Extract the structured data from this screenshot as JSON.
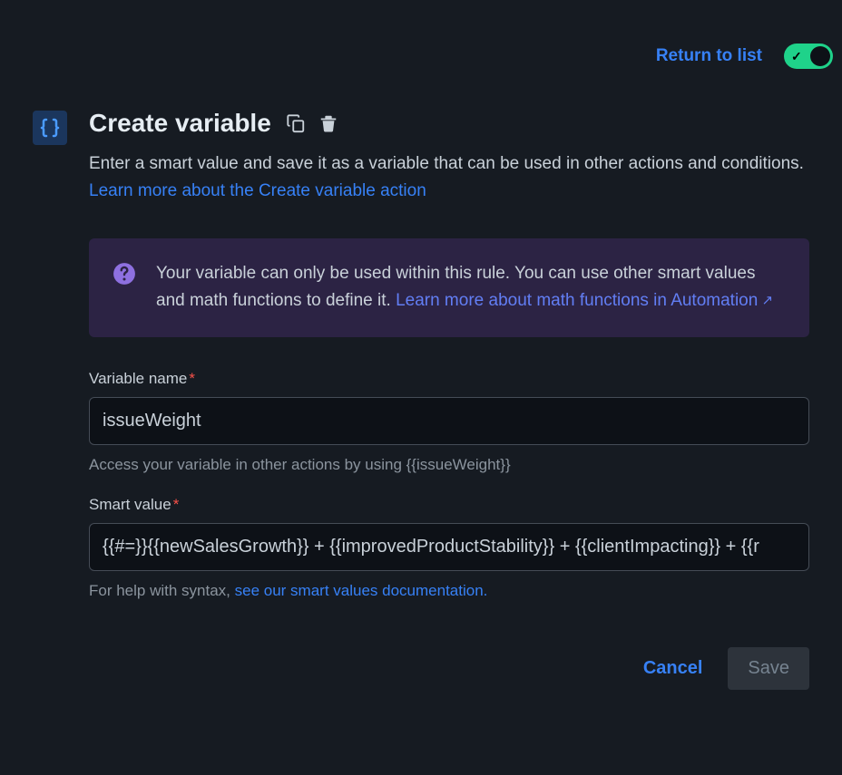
{
  "topbar": {
    "return_label": "Return to list",
    "toggle_on": true
  },
  "header": {
    "title": "Create variable",
    "description_text": "Enter a smart value and save it as a variable that can be used in other actions and conditions. ",
    "description_link": "Learn more about the Create variable action"
  },
  "info_panel": {
    "text_part1": "Your variable can only be used within this rule. You can use other smart values and math functions to define it. ",
    "link_text": "Learn more about math functions in Automation",
    "arrow": " ↗"
  },
  "form": {
    "variable_name": {
      "label": "Variable name",
      "value": "issueWeight",
      "hint": "Access your variable in other actions by using {{issueWeight}}"
    },
    "smart_value": {
      "label": "Smart value",
      "value": "{{#=}}{{newSalesGrowth}} + {{improvedProductStability}} + {{clientImpacting}} + {{r",
      "hint_text": "For help with syntax, ",
      "hint_link": "see our smart values documentation."
    }
  },
  "buttons": {
    "cancel": "Cancel",
    "save": "Save"
  }
}
